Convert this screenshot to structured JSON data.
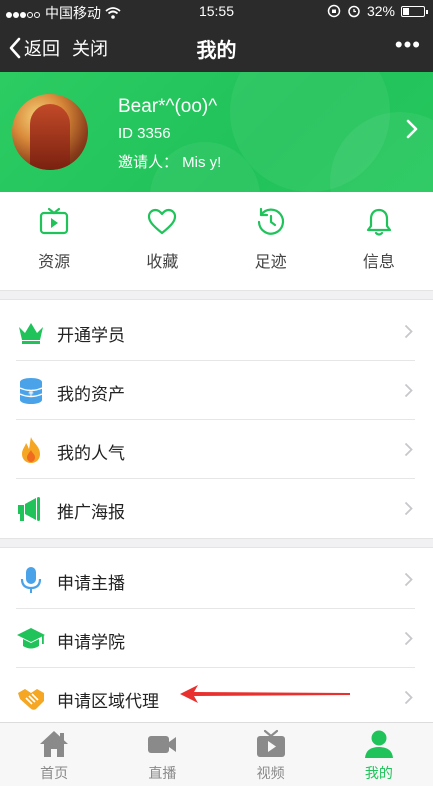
{
  "status_bar": {
    "carrier": "中国移动",
    "time": "15:55",
    "battery": "32%",
    "battery_level": 0.32
  },
  "nav": {
    "back_label": "返回",
    "close_label": "关闭",
    "title": "我的",
    "more_label": "•••"
  },
  "profile": {
    "name": "Bear*^(oo)^",
    "id_text": "ID 3356",
    "inviter_text": "邀请人： Mis y!"
  },
  "quick_actions": [
    {
      "label": "资源",
      "icon": "tv-icon"
    },
    {
      "label": "收藏",
      "icon": "heart-icon"
    },
    {
      "label": "足迹",
      "icon": "history-icon"
    },
    {
      "label": "信息",
      "icon": "bell-icon"
    }
  ],
  "menu_group_1": [
    {
      "label": "开通学员",
      "icon": "crown-icon"
    },
    {
      "label": "我的资产",
      "icon": "coins-icon"
    },
    {
      "label": "我的人气",
      "icon": "fire-icon"
    },
    {
      "label": "推广海报",
      "icon": "megaphone-icon"
    }
  ],
  "menu_group_2": [
    {
      "label": "申请主播",
      "icon": "microphone-icon"
    },
    {
      "label": "申请学院",
      "icon": "graduation-cap-icon"
    },
    {
      "label": "申请区域代理",
      "icon": "handshake-icon"
    }
  ],
  "tabs": [
    {
      "label": "首页",
      "icon": "home-icon",
      "active": false
    },
    {
      "label": "直播",
      "icon": "video-camera-icon",
      "active": false
    },
    {
      "label": "视频",
      "icon": "play-tv-icon",
      "active": false
    },
    {
      "label": "我的",
      "icon": "user-icon",
      "active": true
    }
  ],
  "colors": {
    "brand_green": "#21c25a",
    "dark_bar": "#2b2b2b",
    "annotation_red": "#e8312f"
  }
}
